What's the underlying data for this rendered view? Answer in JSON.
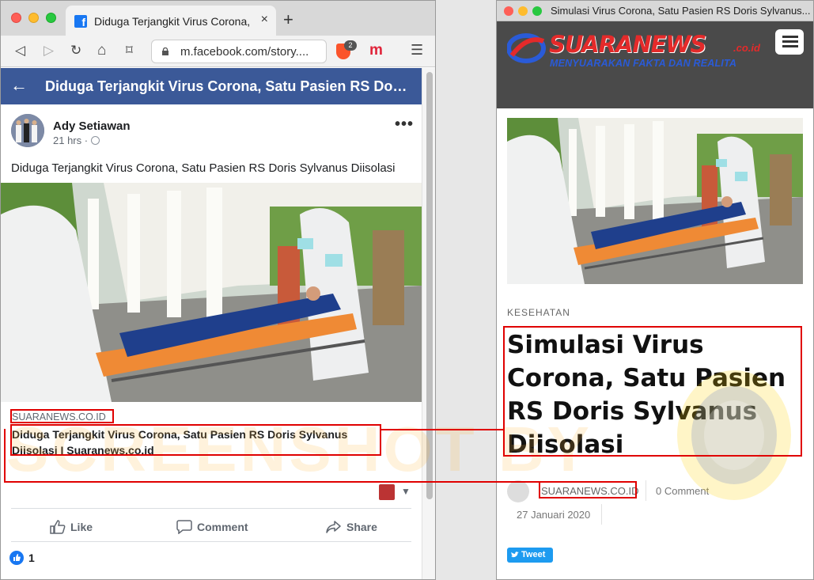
{
  "left_window": {
    "tab_title": "Diduga Terjangkit Virus Corona, Sa",
    "tab_close": "×",
    "new_tab": "+",
    "url": "m.facebook.com/story....",
    "brave_count": "2",
    "ext_label": "m",
    "menu_glyph": "☰",
    "nav": {
      "back": "◁",
      "forward": "▷",
      "reload": "↻",
      "home": "⌂",
      "bookmark": "⌑"
    }
  },
  "facebook": {
    "bar_title": "Diduga Terjangkit Virus Corona, Satu Pasien RS Do…",
    "back_glyph": "←",
    "post": {
      "author": "Ady Setiawan",
      "time": "21 hrs ·",
      "more": "•••",
      "text": "Diduga Terjangkit Virus Corona, Satu Pasien RS Doris Sylvanus Diisolasi",
      "link_domain": "SUARANEWS.CO.ID",
      "link_title": "Diduga Terjangkit Virus Corona, Satu Pasien RS Doris Sylvanus Diisolasi I Suaranews.co.id",
      "caret": "▼",
      "like_label": "Like",
      "comment_label": "Comment",
      "share_label": "Share",
      "like_count": "1"
    }
  },
  "right_window": {
    "title": "Simulasi Virus Corona, Satu Pasien RS Doris Sylvanus...",
    "logo_name": "SUARANEWS",
    "logo_tld": ".co.id",
    "logo_tagline": "MENYUARAKAN FAKTA DAN REALITA",
    "category": "KESEHATAN",
    "headline": "Simulasi Virus Corona, Satu Pasien RS Doris Sylvanus Diisolasi",
    "source": "SUARANEWS.CO.ID",
    "comments": "0 Comment",
    "date": "27 Januari 2020",
    "tweet": "Tweet"
  },
  "overlay": {
    "watermark": "SCREENSHOT BY"
  },
  "colors": {
    "facebook_blue": "#3b5998",
    "highlight_red": "#e00000",
    "site_header": "#4a4a4a",
    "logo_red": "#e42a2a",
    "tagline_blue": "#2a5bd8"
  }
}
